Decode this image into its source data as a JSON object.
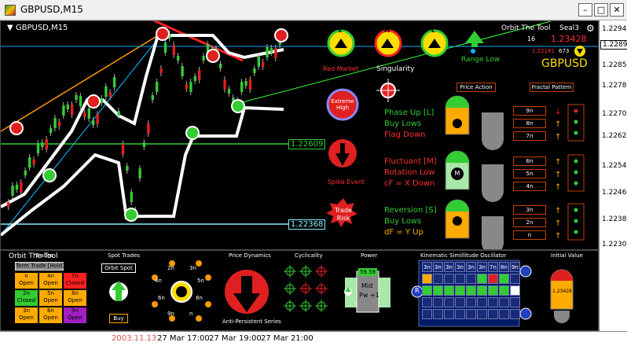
{
  "window": {
    "title": "GBPUSD,M15"
  },
  "chart": {
    "symbol_label": "GBPUSD,M15",
    "header": {
      "title": "Orbit The Tool",
      "seal": "Seal3",
      "num1": "16",
      "num2": "1.23428",
      "num3": "1.22181",
      "num4": "673",
      "symbol": "GBPUSD"
    },
    "lines": {
      "green_level": "1.22609",
      "cyan_level": "1.22368"
    },
    "signals": {
      "s_top": "S",
      "m_top": "M",
      "l_top": "L",
      "range_low": "Range Low",
      "red_market": "Red Market",
      "singularity": "Singularity",
      "extreme_high": "Extreme High",
      "spike_event": "Spike Event",
      "trade_risk": "Trade Risk"
    },
    "buttons": {
      "price_action": "Price Action",
      "fractal_pattern": "Fractal Pattern"
    },
    "phases": [
      {
        "title": "Phase Up [L]",
        "line2": "Buy Lows",
        "line3": "Flag Down",
        "title_color": "#33cc33",
        "l2_color": "#33cc33",
        "l3_color": "#ff3030"
      },
      {
        "title": "Fluctuant [M]",
        "line2": "Rotation Low",
        "line3": "cF = X Down",
        "title_color": "#ff3030",
        "l2_color": "#ff3030",
        "l3_color": "#ff3030"
      },
      {
        "title": "Reversion [S]",
        "line2": "Buy Lows",
        "line3": "dF = Y Up",
        "title_color": "#33cc33",
        "l2_color": "#33cc33",
        "l3_color": "#ffaa00"
      }
    ],
    "badge_m": "M",
    "frames": [
      [
        "9n",
        "8n",
        "7n"
      ],
      [
        "6n",
        "5n",
        "4n"
      ],
      [
        "3n",
        "2n",
        "n"
      ]
    ],
    "price_scale": [
      "1.22940",
      "1.22897",
      "1.22855",
      "1.22780",
      "1.22705",
      "1.22625",
      "1.22545",
      "1.22465",
      "1.22385",
      "1.22305"
    ],
    "current_price": "1.22897"
  },
  "subpanel": {
    "title": "Orbit The Tool",
    "hold_label": "Term Trade [Hold]",
    "trades_label": "Trades",
    "trade_cells": [
      {
        "a": "n",
        "b": "Open",
        "color": "#ffaa00"
      },
      {
        "a": "4n",
        "b": "Open",
        "color": "#ffaa00"
      },
      {
        "a": "7n",
        "b": "Closed",
        "color": "#ff2020"
      },
      {
        "a": "2n",
        "b": "Closed",
        "color": "#33cc33"
      },
      {
        "a": "5n",
        "b": "Open",
        "color": "#ffaa00"
      },
      {
        "a": "8n",
        "b": "Open",
        "color": "#ffaa00"
      },
      {
        "a": "3n",
        "b": "Open",
        "color": "#ffaa00"
      },
      {
        "a": "6n",
        "b": "Open",
        "color": "#ffaa00"
      },
      {
        "a": "9n",
        "b": "Open",
        "color": "#a020c0"
      }
    ],
    "spot_trades": "Spot Trades",
    "orbit_spot": "Orbit Spot",
    "buy": "Buy",
    "dial_labels": [
      "2n",
      "3n",
      "4n",
      "5n",
      "6n",
      "8n",
      "9n",
      "n"
    ],
    "price_dynamics": "Price Dynamics",
    "anti_persistent": "Anti-Persistent Series",
    "cyclicality": "Cyclicality",
    "power": "Power",
    "power_value": "59.59",
    "mid_label": "Mid",
    "pw_label": "Pw +1",
    "kinematic": "Kinematic Simillitude Oscillator",
    "kin_header": [
      "3n",
      "3n",
      "3n",
      "3n",
      "3n",
      "3n",
      "7n",
      "8n",
      "9n"
    ],
    "kin_r": "R",
    "initial_value": "Initial Value",
    "initial_price": "1.23428"
  },
  "time_axis": [
    "2003.11.13",
    "27 Mar 17:00",
    "27 Mar 19:00",
    "27 Mar 21:00"
  ]
}
